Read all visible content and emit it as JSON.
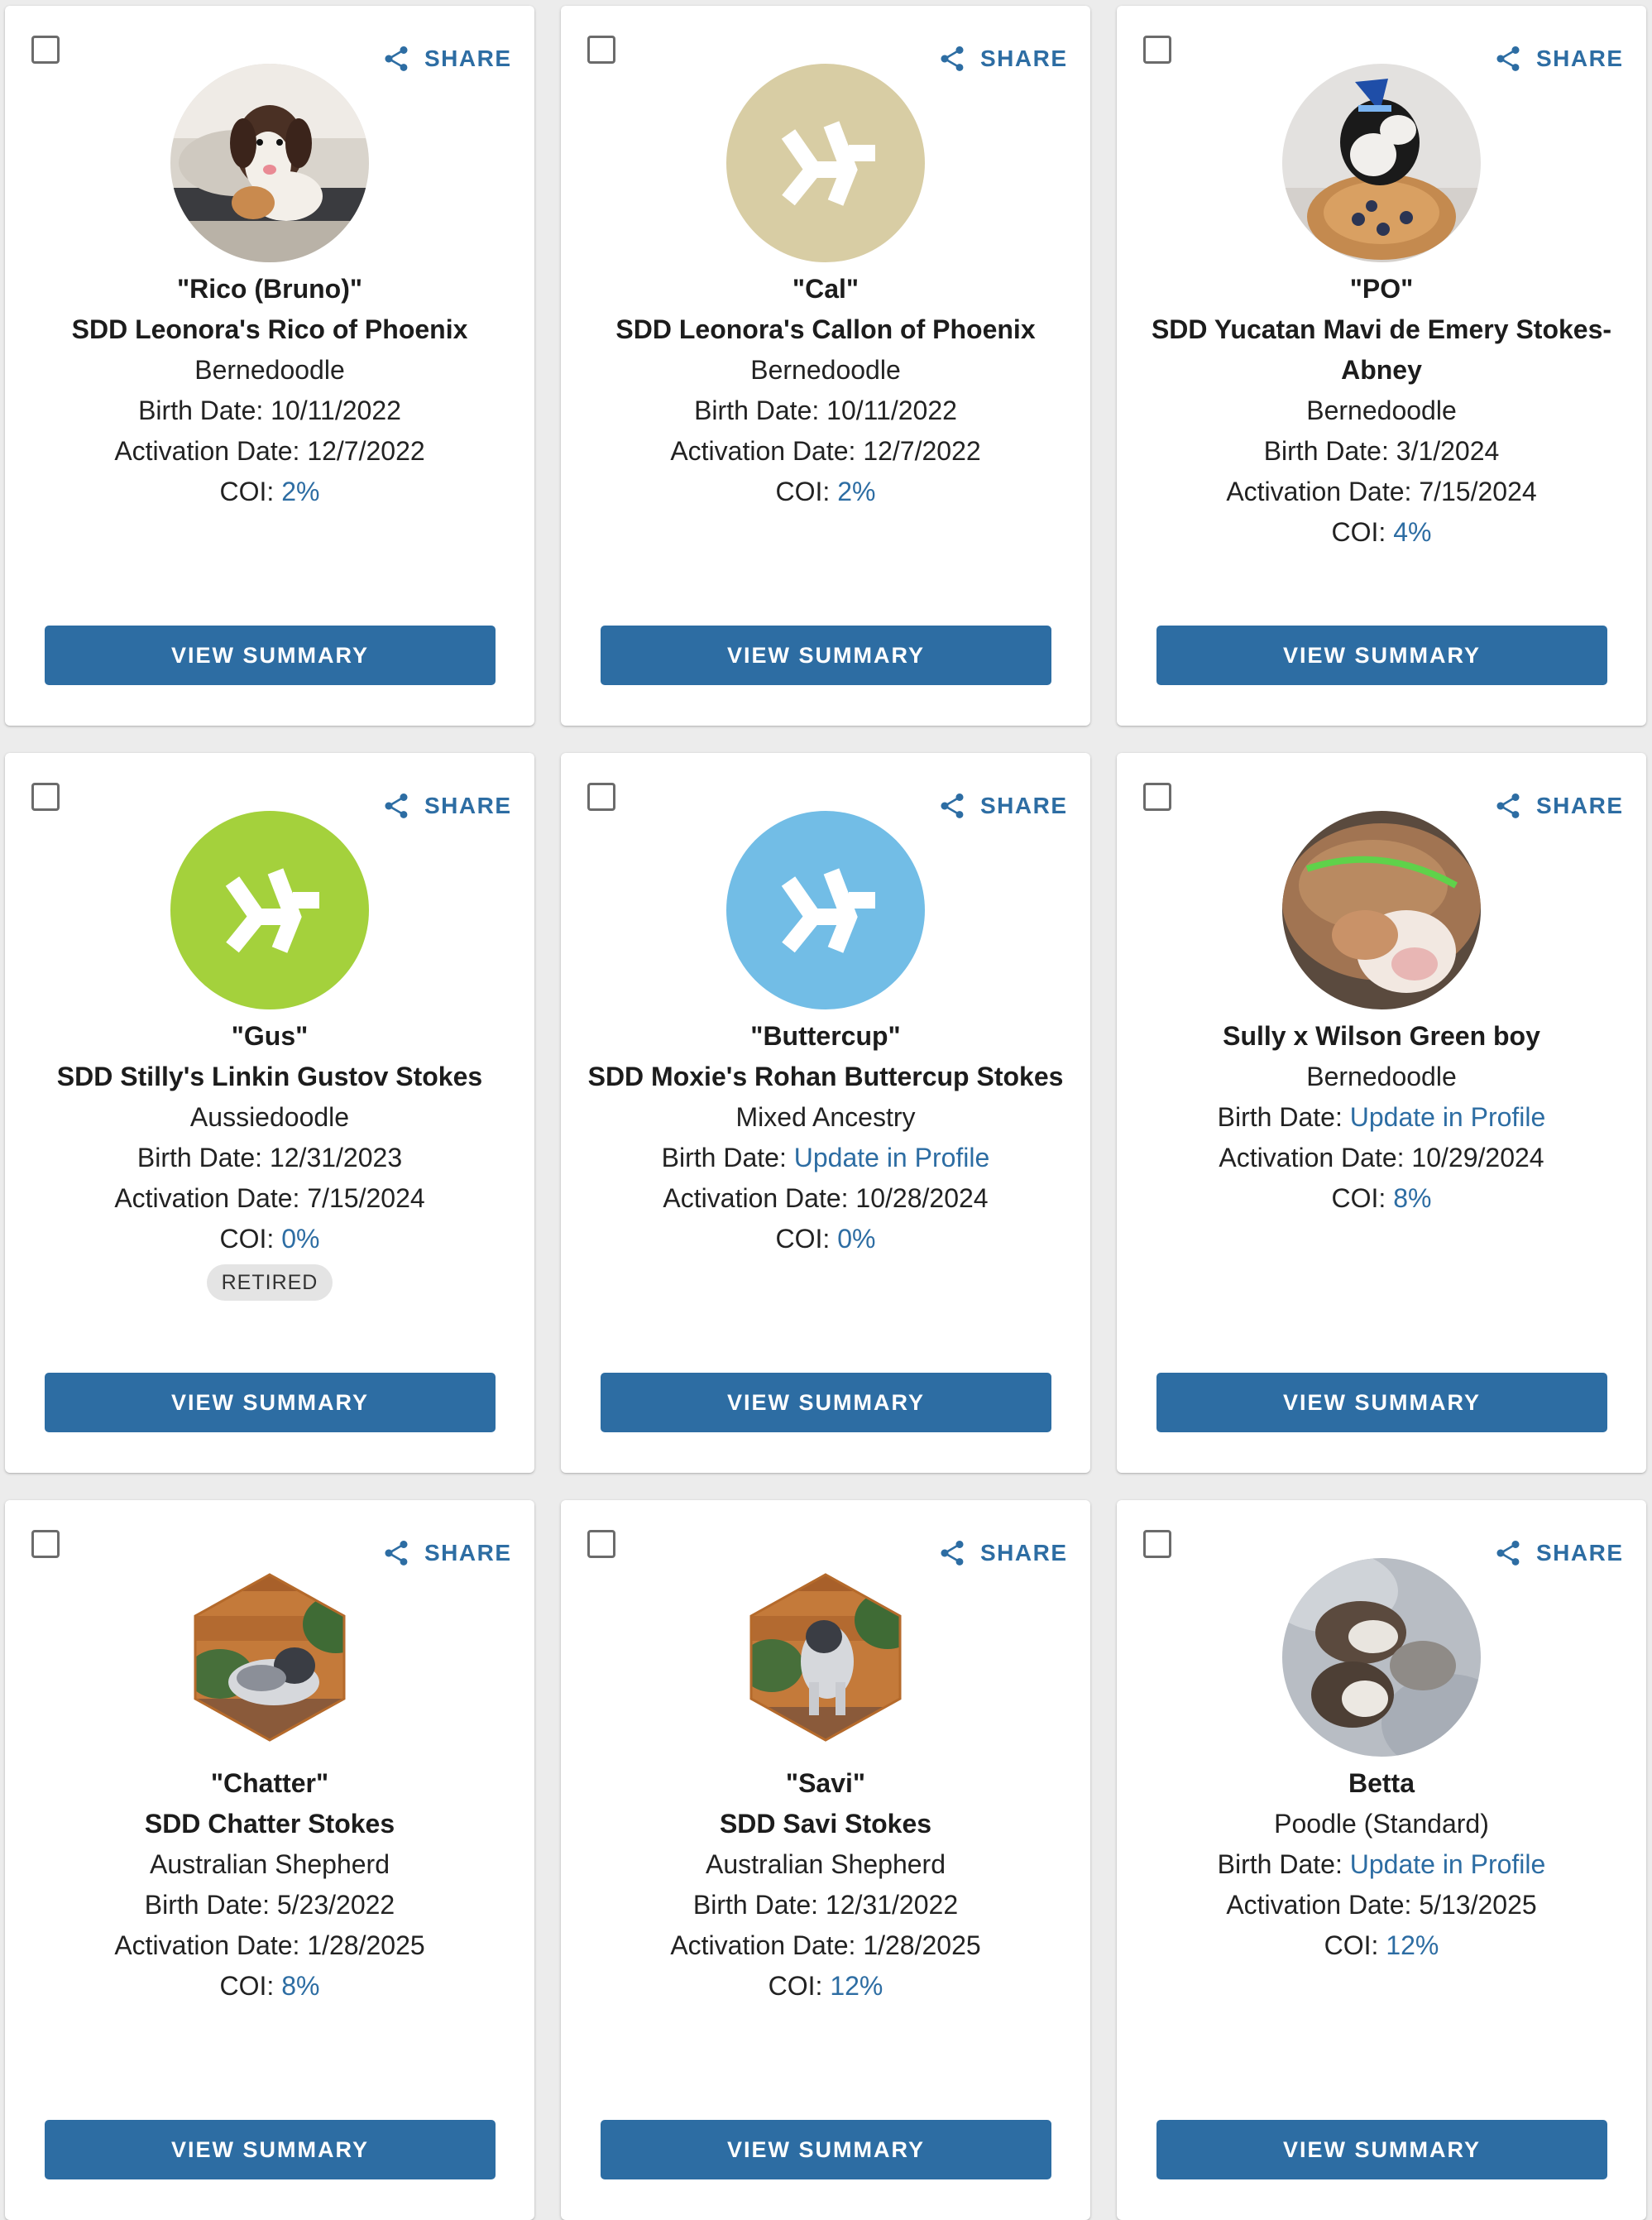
{
  "labels": {
    "share": "SHARE",
    "view_summary": "VIEW SUMMARY",
    "birth_date_prefix": "Birth Date: ",
    "activation_date_prefix": "Activation Date: ",
    "coi_prefix": "COI: ",
    "retired": "RETIRED"
  },
  "colors": {
    "accent": "#2d6da3",
    "placeholder_tan": "#d8cda4",
    "placeholder_green": "#a4d13c",
    "placeholder_blue": "#72bde6"
  },
  "dogs": [
    {
      "nickname": "\"Rico (Bruno)\"",
      "registered_name": "SDD Leonora's Rico of Phoenix",
      "breed": "Bernedoodle",
      "birth_date": "10/11/2022",
      "activation_date": "12/7/2022",
      "coi": "2%",
      "avatar": "photo-circle-dog"
    },
    {
      "nickname": "\"Cal\"",
      "registered_name": "SDD Leonora's Callon of Phoenix",
      "breed": "Bernedoodle",
      "birth_date": "10/11/2022",
      "activation_date": "12/7/2022",
      "coi": "2%",
      "avatar": "placeholder-logo-tan"
    },
    {
      "nickname": "\"PO\"",
      "registered_name": "SDD Yucatan Mavi de Emery Stokes-Abney",
      "breed": "Bernedoodle",
      "birth_date": "3/1/2024",
      "activation_date": "7/15/2024",
      "coi": "4%",
      "avatar": "photo-circle-puppy-party"
    },
    {
      "nickname": "\"Gus\"",
      "registered_name": "SDD Stilly's Linkin Gustov Stokes",
      "breed": "Aussiedoodle",
      "birth_date": "12/31/2023",
      "activation_date": "7/15/2024",
      "coi": "0%",
      "retired": true,
      "avatar": "placeholder-logo-green"
    },
    {
      "nickname": "\"Buttercup\"",
      "registered_name": "SDD Moxie's Rohan Buttercup Stokes",
      "breed": "Mixed Ancestry",
      "birth_date": "Update in Profile",
      "birth_date_is_link": true,
      "activation_date": "10/28/2024",
      "coi": "0%",
      "avatar": "placeholder-logo-blue"
    },
    {
      "nickname": "",
      "registered_name": "Sully x Wilson Green boy",
      "breed": "Bernedoodle",
      "birth_date": "Update in Profile",
      "birth_date_is_link": true,
      "activation_date": "10/29/2024",
      "coi": "8%",
      "avatar": "photo-circle-newborn"
    },
    {
      "nickname": "\"Chatter\"",
      "registered_name": "SDD Chatter Stokes",
      "breed": "Australian Shepherd",
      "birth_date": "5/23/2022",
      "activation_date": "1/28/2025",
      "coi": "8%",
      "avatar": "photo-hexagon-aussie-lying"
    },
    {
      "nickname": "\"Savi\"",
      "registered_name": "SDD Savi Stokes",
      "breed": "Australian Shepherd",
      "birth_date": "12/31/2022",
      "activation_date": "1/28/2025",
      "coi": "12%",
      "avatar": "photo-hexagon-aussie-standing"
    },
    {
      "nickname": "",
      "registered_name": "Betta",
      "breed": "Poodle (Standard)",
      "birth_date": "Update in Profile",
      "birth_date_is_link": true,
      "activation_date": "5/13/2025",
      "coi": "12%",
      "avatar": "photo-circle-puppies-sleeping"
    }
  ]
}
